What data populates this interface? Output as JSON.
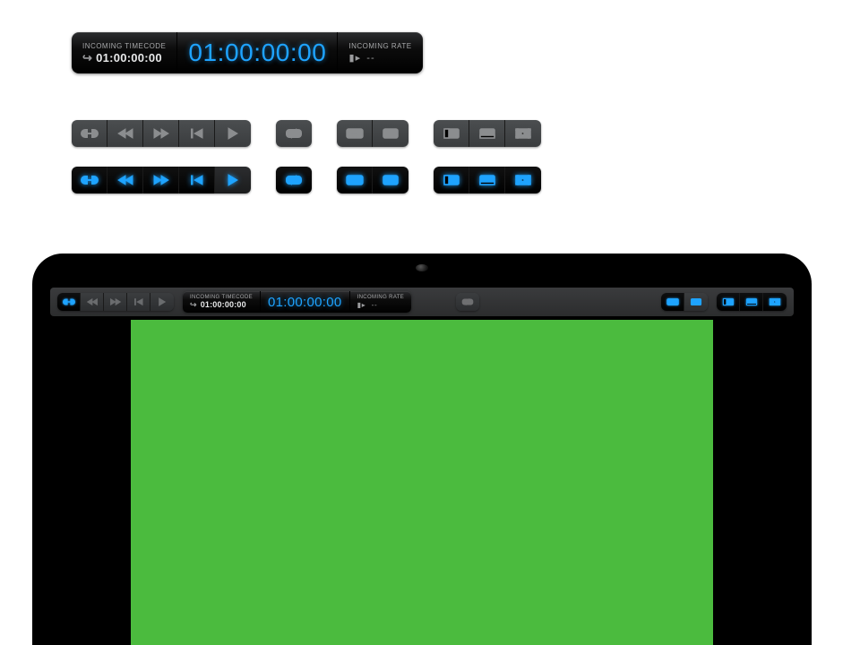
{
  "timecode_panel": {
    "incoming_label": "INCOMING TIMECODE",
    "incoming_value": "01:00:00:00",
    "main_value": "01:00:00:00",
    "rate_label": "INCOMING RATE",
    "rate_value": "--"
  },
  "colors": {
    "accent": "#1ea3ff",
    "green_screen": "#4bbb3e"
  }
}
